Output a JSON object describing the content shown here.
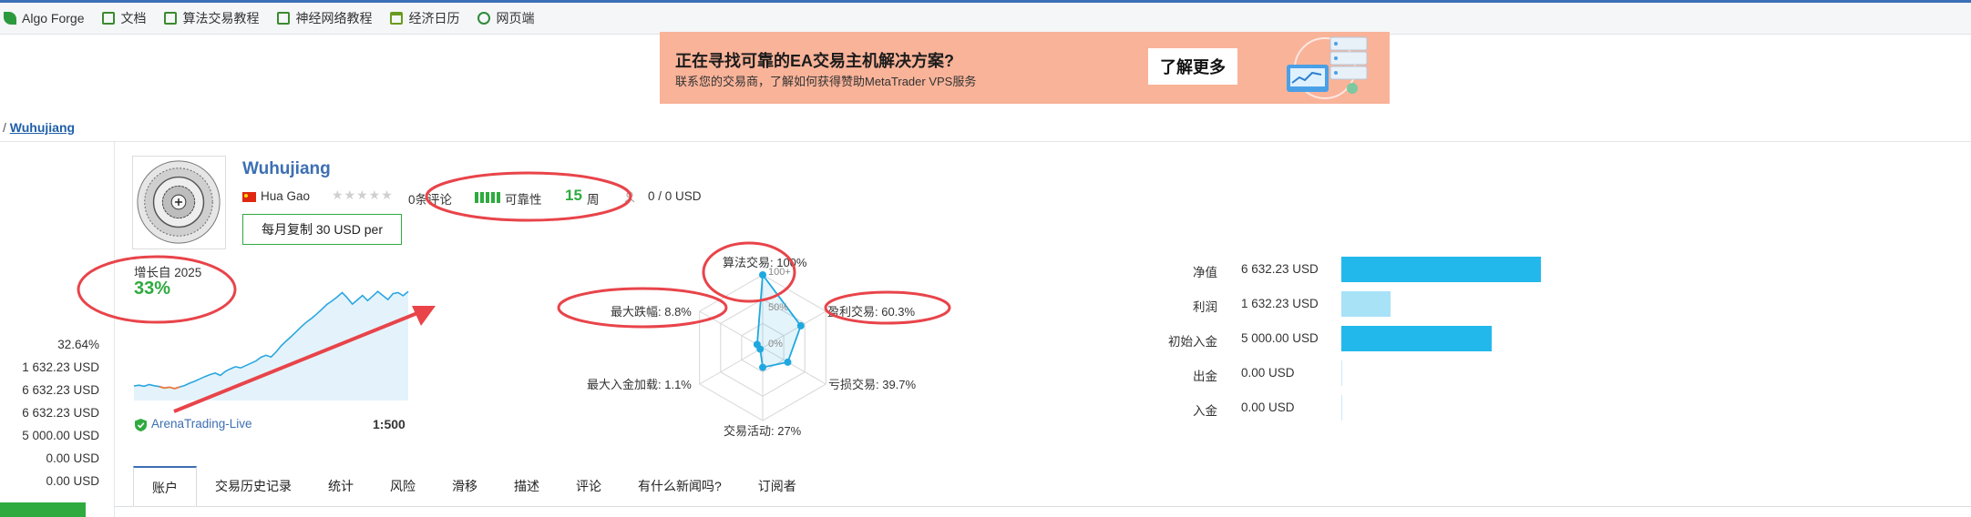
{
  "bookmarks": [
    {
      "label": "Algo Forge",
      "icon": "leaf-icon"
    },
    {
      "label": "文档",
      "icon": "document-icon"
    },
    {
      "label": "算法交易教程",
      "icon": "document-icon"
    },
    {
      "label": "神经网络教程",
      "icon": "document-icon"
    },
    {
      "label": "经济日历",
      "icon": "calendar-icon"
    },
    {
      "label": "网页端",
      "icon": "globe-icon"
    }
  ],
  "banner": {
    "title": "正在寻找可靠的EA交易主机解决方案?",
    "subtitle": "联系您的交易商，了解如何获得赞助MetaTrader VPS服务",
    "button": "了解更多",
    "background_color": "#f9b399"
  },
  "breadcrumb": {
    "separator": "/",
    "current": "Wuhujiang"
  },
  "left_values": [
    "32.64%",
    "1 632.23 USD",
    "6 632.23 USD",
    "6 632.23 USD",
    "5 000.00 USD",
    "0.00 USD",
    "0.00 USD"
  ],
  "signal": {
    "name": "Wuhujiang",
    "author": "Hua Gao",
    "reviews_text": "0条评论",
    "reliability_label": "可靠性",
    "weeks_value": "15",
    "weeks_label": "周",
    "subscribers": "0 / 0 USD",
    "copy_button": "每月复制 30 USD per",
    "growth_label": "增长自 2025",
    "growth_value": "33%",
    "broker": "ArenaTrading-Live",
    "leverage": "1:500"
  },
  "sparkline": {
    "note_values_in_percent": true,
    "points": [
      0.5,
      0.8,
      0.4,
      1.0,
      0.6,
      0.3,
      -0.2,
      0.1,
      -0.4,
      0.2,
      0.7,
      1.5,
      2.2,
      3.0,
      3.8,
      4.5,
      5.0,
      4.2,
      5.6,
      6.5,
      7.2,
      6.8,
      7.6,
      8.4,
      9.2,
      10.5,
      11.2,
      10.6,
      12.4,
      14.5,
      16.2,
      17.8,
      19.5,
      21.2,
      22.8,
      24.1,
      25.6,
      27.2,
      28.9,
      30.1,
      31.5,
      33.0,
      31.2,
      29.0,
      30.5,
      32.0,
      30.2,
      31.8,
      33.4,
      32.0,
      30.6,
      32.64,
      33.0,
      31.9,
      33.4
    ]
  },
  "radar": {
    "labels": {
      "algo": "算法交易: 100%",
      "profit": "盈利交易: 60.3%",
      "loss": "亏损交易: 39.7%",
      "activity": "交易活动: 27%",
      "deposit_load": "最大入金加载: 1.1%",
      "drawdown": "最大跌幅: 8.8%"
    },
    "ticks": [
      "100+",
      "50%",
      "0%"
    ],
    "values": [
      100,
      60.3,
      39.7,
      27,
      1.1,
      8.8
    ]
  },
  "metrics": [
    {
      "label": "净值",
      "value": "6 632.23 USD",
      "fraction": 0.342,
      "color": "#22b8ec"
    },
    {
      "label": "利润",
      "value": "1 632.23 USD",
      "fraction": 0.084,
      "color": "#a8e2f7"
    },
    {
      "label": "初始入金",
      "value": "5 000.00 USD",
      "fraction": 0.258,
      "color": "#22b8ec"
    },
    {
      "label": "出金",
      "value": "0.00 USD",
      "fraction": 0,
      "color": "#22b8ec"
    },
    {
      "label": "入金",
      "value": "0.00 USD",
      "fraction": 0,
      "color": "#22b8ec"
    }
  ],
  "tabs": [
    "账户",
    "交易历史记录",
    "统计",
    "风险",
    "滑移",
    "描述",
    "评论",
    "有什么新闻吗?",
    "订阅者"
  ],
  "colors": {
    "accent": "#3c6fb3",
    "green": "#2faa3f",
    "annotation": "#e8444a",
    "radar_line": "#1fa8e0"
  }
}
